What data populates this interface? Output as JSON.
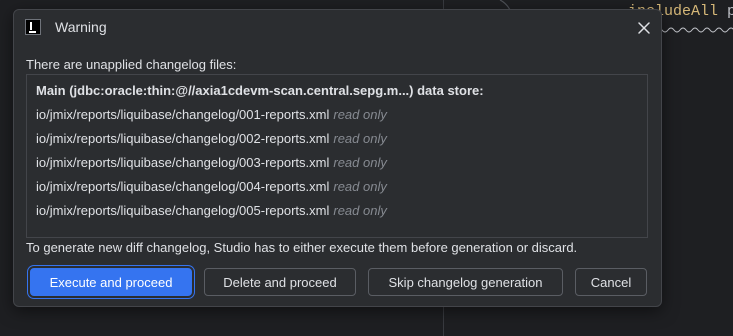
{
  "editor": {
    "code_keyword": "includeAll",
    "code_rest": " pa"
  },
  "dialog": {
    "title": "Warning",
    "message": "There are unapplied changelog files:",
    "data_store_header": "Main (jdbc:oracle:thin:@//axia1cdevm-scan.central.sepg.m...) data store:",
    "files": [
      {
        "path": "io/jmix/reports/liquibase/changelog/001-reports.xml",
        "status": "read only"
      },
      {
        "path": "io/jmix/reports/liquibase/changelog/002-reports.xml",
        "status": "read only"
      },
      {
        "path": "io/jmix/reports/liquibase/changelog/003-reports.xml",
        "status": "read only"
      },
      {
        "path": "io/jmix/reports/liquibase/changelog/004-reports.xml",
        "status": "read only"
      },
      {
        "path": "io/jmix/reports/liquibase/changelog/005-reports.xml",
        "status": "read only"
      }
    ],
    "footer": "To generate new diff changelog, Studio has to either execute them before generation or discard.",
    "buttons": {
      "execute": "Execute and proceed",
      "delete": "Delete and proceed",
      "skip": "Skip changelog generation",
      "cancel": "Cancel"
    }
  },
  "colors": {
    "accent": "#3574f0",
    "dialog_bg": "#2b2d30",
    "editor_bg": "#1e1f22",
    "muted": "#868a91"
  }
}
